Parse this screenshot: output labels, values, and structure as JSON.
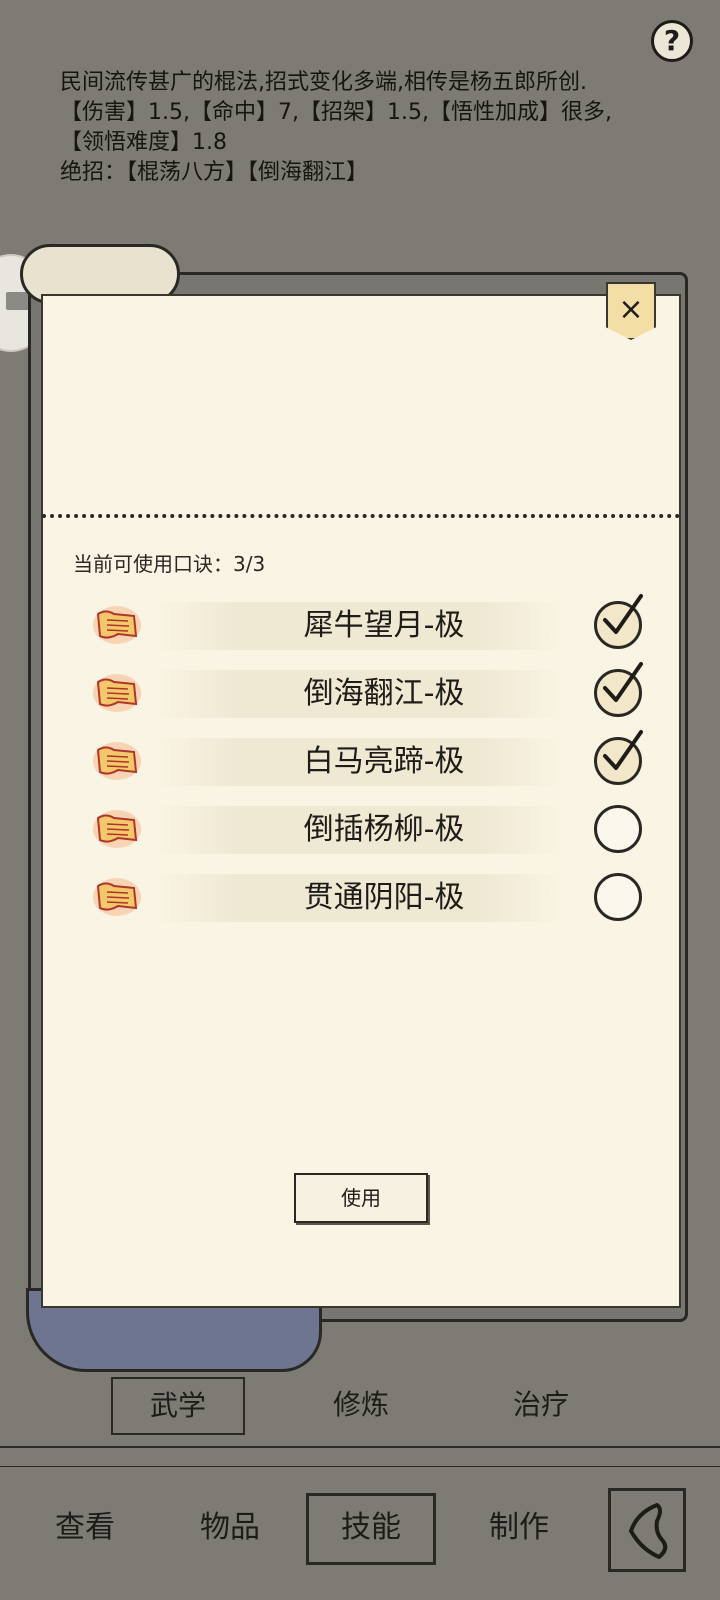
{
  "description": {
    "line1": "民间流传甚广的棍法,招式变化多端,相传是杨五郎所创.",
    "line2": "【伤害】1.5,【命中】7,【招架】1.5,【悟性加成】很多,",
    "line3": "【领悟难度】1.8",
    "line4": "绝招：【棍荡八方】【倒海翻江】"
  },
  "help_label": "?",
  "close_label": "×",
  "counter": {
    "label": "当前可使用口诀：",
    "value": "3/3"
  },
  "skills": [
    {
      "name": "犀牛望月-极",
      "checked": true
    },
    {
      "name": "倒海翻江-极",
      "checked": true
    },
    {
      "name": "白马亮蹄-极",
      "checked": true
    },
    {
      "name": "倒插杨柳-极",
      "checked": false
    },
    {
      "name": "贯通阴阳-极",
      "checked": false
    }
  ],
  "use_button": "使用",
  "sub_tabs": [
    "武学",
    "修炼",
    "治疗"
  ],
  "nav_tabs": [
    "查看",
    "物品",
    "技能",
    "制作"
  ],
  "colors": {
    "panel": "#faf4e4",
    "background": "#7d7b74",
    "accent": "#f3dfa6",
    "roll_blue": "#6e7591"
  }
}
